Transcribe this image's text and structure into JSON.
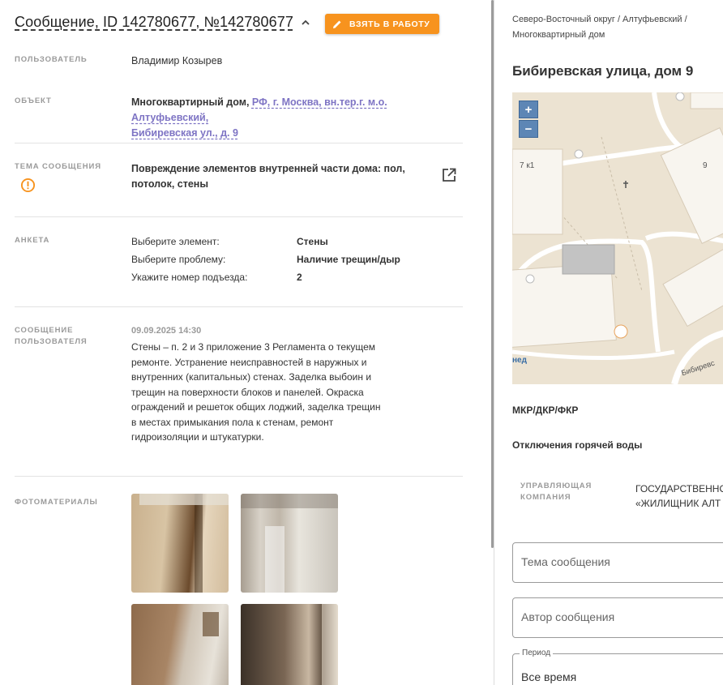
{
  "message": {
    "title": "Сообщение, ID 142780677, №142780677",
    "take_button": "ВЗЯТЬ В РАБОТУ"
  },
  "fields": {
    "user_label": "ПОЛЬЗОВАТЕЛЬ",
    "user_value": "Владимир Козырев",
    "object_label": "ОБЪЕКТ",
    "object_type": "Многоквартирный дом,",
    "object_addr_1": "РФ, г. Москва, вн.тер.г. м.о. Алтуфьевский,",
    "object_addr_2": "Бибиревская ул., д. 9",
    "topic_label": "ТЕМА СООБЩЕНИЯ",
    "topic_value": "Повреждение элементов внутренней части дома: пол, потолок, стены",
    "anketa_label": "АНКЕТА",
    "user_msg_label": "СООБЩЕНИЕ ПОЛЬЗОВАТЕЛЯ",
    "photos_label": "ФОТОМАТЕРИАЛЫ"
  },
  "anketa": [
    {
      "q": "Выберите элемент:",
      "a": "Стены"
    },
    {
      "q": "Выберите проблему:",
      "a": "Наличие трещин/дыр"
    },
    {
      "q": "Укажите номер подъезда:",
      "a": "2"
    }
  ],
  "user_message": {
    "date": "09.09.2025 14:30",
    "text": "Стены – п. 2 и 3 приложение 3 Регламента о текущем ремонте. Устранение неисправностей в наружных и внутренних (капитальных) стенах. Заделка выбоин и трещин на поверхности блоков и панелей. Окраска ограждений и решеток общих лоджий, заделка трещин в местах примыкания пола к стенам, ремонт гидроизоляции и штукатурки."
  },
  "right": {
    "breadcrumb": "Северо-Восточный округ / Алтуфьевский / Многоквартирный дом",
    "address": "Бибиревская улица, дом 9",
    "map": {
      "label_7k1": "7 к1",
      "label_9": "9",
      "label_street": "Бибиревс",
      "label_ned": "нед",
      "zoom_in": "+",
      "zoom_out": "−"
    },
    "link_mkr": "МКР/ДКР/ФКР",
    "link_hot_water": "Отключения горячей воды",
    "mc_label_1": "УПРАВЛЯЮЩАЯ",
    "mc_label_2": "КОМПАНИЯ",
    "mc_value_1": "ГОСУДАРСТВЕННО",
    "mc_value_2": "«ЖИЛИЩНИК АЛТ",
    "filter_topic_placeholder": "Тема сообщения",
    "filter_author_placeholder": "Автор сообщения",
    "period_legend": "Период",
    "period_value": "Все время"
  },
  "colors": {
    "accent": "#f7931e",
    "link": "#7e74c4",
    "warning": "#f7931e"
  }
}
